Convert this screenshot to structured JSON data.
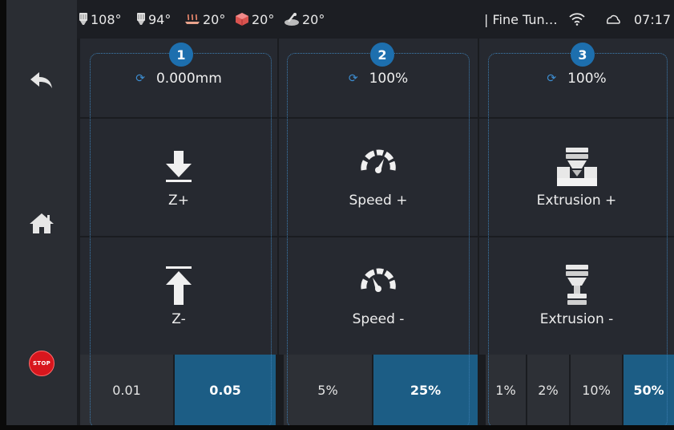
{
  "status": {
    "temps": [
      {
        "icon": "nozzle-icon",
        "value": "108°"
      },
      {
        "icon": "nozzle-icon",
        "value": "94°"
      },
      {
        "icon": "bed-icon",
        "value": "20°"
      },
      {
        "icon": "chamber-icon",
        "value": "20°"
      },
      {
        "icon": "sensor-icon",
        "value": "20°"
      }
    ],
    "title": "| Fine Tun…",
    "time": "07:17",
    "wifi_icon": "wifi-icon",
    "cloud_icon": "cloud-icon"
  },
  "sidebar": {
    "back_icon": "back-arrow-icon",
    "home_icon": "home-icon",
    "stop_label": "STOP"
  },
  "panels": [
    {
      "badge": "1",
      "value": "0.000mm",
      "up_label": "Z+",
      "down_label": "Z-",
      "steps": [
        "0.01",
        "0.05"
      ],
      "active_step": "0.05"
    },
    {
      "badge": "2",
      "value": "100%",
      "up_label": "Speed +",
      "down_label": "Speed -",
      "steps": [
        "5%",
        "25%"
      ],
      "active_step": "25%"
    },
    {
      "badge": "3",
      "value": "100%",
      "up_label": "Extrusion +",
      "down_label": "Extrusion -",
      "steps": [
        "1%",
        "2%",
        "10%",
        "50%"
      ],
      "active_step": "50%"
    }
  ],
  "colors": {
    "accent": "#1d6fae",
    "active_step": "#1c5d85",
    "stop": "#d8161d",
    "dotted_outline": "#3e7fb4"
  }
}
